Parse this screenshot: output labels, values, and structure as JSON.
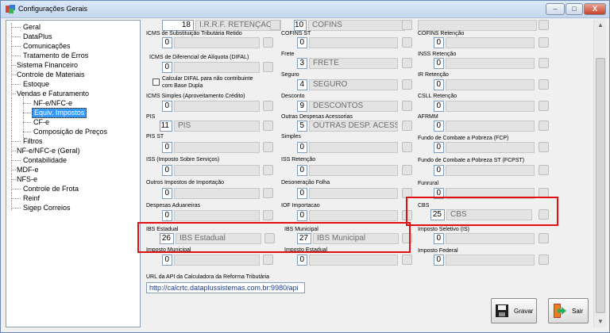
{
  "window": {
    "title": "Configurações Gerais",
    "min": "–",
    "max": "□",
    "close": "X"
  },
  "tree": [
    {
      "label": "Geral"
    },
    {
      "label": "DataPlus"
    },
    {
      "label": "Comunicações"
    },
    {
      "label": "Tratamento de Erros"
    },
    {
      "label": "Sistema Financeiro"
    },
    {
      "label": "Controle de Materiais"
    },
    {
      "label": "Estoque"
    },
    {
      "label": "Vendas e Faturamento"
    },
    {
      "label": "NF-e/NFC-e"
    },
    {
      "label": "Equiv. Impostos"
    },
    {
      "label": "CF-e"
    },
    {
      "label": "Composição de Preços"
    },
    {
      "label": "Filtros"
    },
    {
      "label": "NF-e/NFC-e (Geral)"
    },
    {
      "label": "Contabilidade"
    },
    {
      "label": "MDF-e"
    },
    {
      "label": "NFS-e"
    },
    {
      "label": "Controle de Frota"
    },
    {
      "label": "Reinf"
    },
    {
      "label": "Sigep Correios"
    }
  ],
  "col1": {
    "irrf": {
      "code": "18",
      "desc": "I.R.R.F. RETENÇÃO"
    },
    "icms_st_retido": {
      "label": "ICMS de Substituição Tributária Retido",
      "code": "0"
    },
    "difal": {
      "label": "ICMS de Diferencial de Alíquota (DIFAL)",
      "code": "0"
    },
    "difal_check": "Calcular DIFAL para não contribuinte com Base Dupla",
    "icms_simples": {
      "label": "ICMS Simples (Aproveitamento Crédito)",
      "code": "0"
    },
    "pis": {
      "label": "PIS",
      "code": "11",
      "desc": "PIS"
    },
    "pis_st": {
      "label": "PIS ST",
      "code": "0"
    },
    "iss": {
      "label": "ISS (Imposto Sobre Serviços)",
      "code": "0"
    },
    "outros_imp": {
      "label": "Outros Impostos de Importação",
      "code": "0"
    },
    "despesas_adu": {
      "label": "Despesas Aduaneiras",
      "code": "0"
    },
    "ibs_estadual": {
      "label": "IBS Estadual",
      "code": "26",
      "desc": "IBS Estadual"
    },
    "imp_municipal": {
      "label": "Imposto Municipal",
      "code": "0"
    }
  },
  "col2": {
    "cofins": {
      "code": "10",
      "desc": "COFINS"
    },
    "cofins_st": {
      "label": "COFINS ST",
      "code": "0"
    },
    "frete": {
      "label": "Frete",
      "code": "3",
      "desc": "FRETE"
    },
    "seguro": {
      "label": "Seguro",
      "code": "4",
      "desc": "SEGURO"
    },
    "desconto": {
      "label": "Desconto",
      "code": "9",
      "desc": "DESCONTOS"
    },
    "outras_desp": {
      "label": "Outras Despesas Acessorias",
      "code": "5",
      "desc": "OUTRAS DESP. ACESSÓ"
    },
    "simples": {
      "label": "Simples",
      "code": "0"
    },
    "iss_ret": {
      "label": "ISS Retenção",
      "code": "0"
    },
    "desoneracao": {
      "label": "Desoneração Folha",
      "code": "0"
    },
    "iof": {
      "label": "IOF Importacao",
      "code": "0"
    },
    "ibs_municipal": {
      "label": "IBS Municipal",
      "code": "27",
      "desc": "IBS Municipal"
    },
    "imp_estadual": {
      "label": "Imposto Estadual",
      "code": "0"
    }
  },
  "col3": {
    "cofins_ret": {
      "label": "COFINS Retenção",
      "code": "0"
    },
    "inss_ret": {
      "label": "INSS Retenção",
      "code": "0"
    },
    "ir_ret": {
      "label": "IR Retenção",
      "code": "0"
    },
    "csll_ret": {
      "label": "CSLL Retenção",
      "code": "0"
    },
    "afrmm": {
      "label": "AFRMM",
      "code": "0"
    },
    "fcp": {
      "label": "Fundo de Combate a Pobreza (FCP)",
      "code": "0"
    },
    "fcpst": {
      "label": "Fundo de Combate a Pobreza ST (FCPST)",
      "code": "0"
    },
    "funrural": {
      "label": "Funrural",
      "code": "0"
    },
    "cbs": {
      "label": "CBS",
      "code": "25",
      "desc": "CBS"
    },
    "imp_seletivo": {
      "label": "Imposto Seletivo (IS)",
      "code": "0"
    },
    "imp_federal": {
      "label": "Imposto Federal",
      "code": "0"
    }
  },
  "api": {
    "label": "URL da API da Calculadora da Reforma Tributária",
    "value": "http://calcrtc.dataplussistemas.com.br:9980/api"
  },
  "buttons": {
    "gravar": "Gravar",
    "sair": "Sair"
  },
  "colors": {
    "highlight": "#e01010",
    "selection": "#3399ff"
  }
}
